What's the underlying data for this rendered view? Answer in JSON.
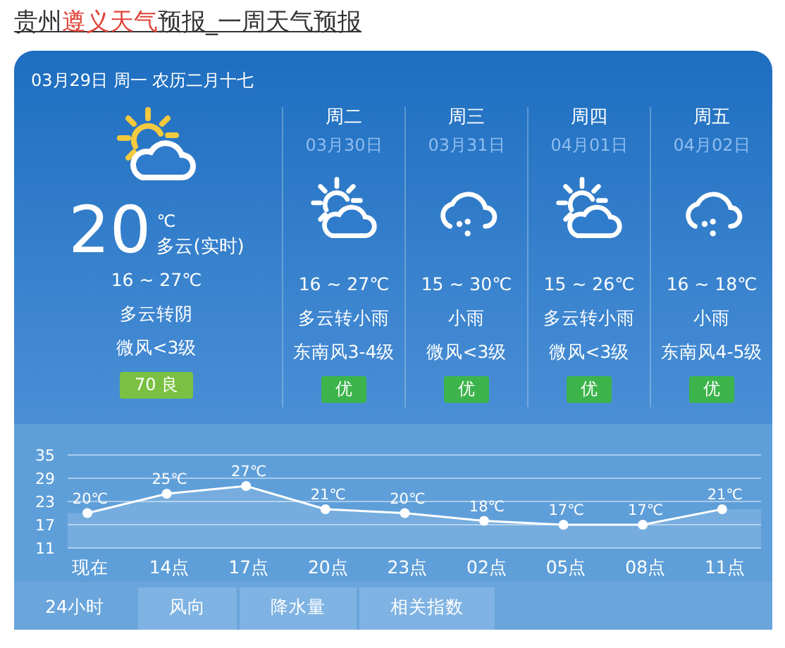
{
  "title": [
    {
      "text": "贵州",
      "highlight": false
    },
    {
      "text": "遵义天气",
      "highlight": true
    },
    {
      "text": "预报_一周天气预报",
      "highlight": false
    }
  ],
  "today": {
    "date": "03月29日 周一 农历二月十七",
    "kind": "partly-cloudy",
    "temp": "20",
    "unit": "℃",
    "now": "多云(实时)",
    "range": "16 ~ 27℃",
    "desc": "多云转阴",
    "wind": "微风<3级",
    "aqi": "70 良",
    "color": "#7ac143"
  },
  "days": [
    {
      "name": "周二",
      "date": "03月30日",
      "kind": "partly-cloudy",
      "range": "16 ~ 27℃",
      "desc": "多云转小雨",
      "wind": "东南风3-4级",
      "aqi": "优",
      "color": "#3cb44b"
    },
    {
      "name": "周三",
      "date": "03月31日",
      "kind": "rain",
      "range": "15 ~ 30℃",
      "desc": "小雨",
      "wind": "微风<3级",
      "aqi": "优",
      "color": "#3cb44b"
    },
    {
      "name": "周四",
      "date": "04月01日",
      "kind": "partly-cloudy",
      "range": "15 ~ 26℃",
      "desc": "多云转小雨",
      "wind": "微风<3级",
      "aqi": "优",
      "color": "#3cb44b"
    },
    {
      "name": "周五",
      "date": "04月02日",
      "kind": "rain",
      "range": "16 ~ 18℃",
      "desc": "小雨",
      "wind": "东南风4-5级",
      "aqi": "优",
      "color": "#3cb44b"
    }
  ],
  "chart_data": {
    "type": "line",
    "categories": [
      "现在",
      "14点",
      "17点",
      "20点",
      "23点",
      "02点",
      "05点",
      "08点",
      "11点"
    ],
    "series": [
      {
        "color": "#ffffff",
        "marker": true,
        "values": [
          20,
          25,
          27,
          21,
          20,
          18,
          17,
          17,
          21
        ]
      }
    ],
    "grid": true,
    "ylim": [
      11,
      35
    ],
    "yticks": [
      11,
      17,
      23,
      29,
      35
    ],
    "value_labels": [
      "20℃",
      "25℃",
      "27℃",
      "21℃",
      "20℃",
      "18℃",
      "17℃",
      "17℃",
      "21℃"
    ]
  },
  "tabs": [
    {
      "label": "24小时",
      "selected": true
    },
    {
      "label": "风向",
      "selected": false
    },
    {
      "label": "降水量",
      "selected": false
    },
    {
      "label": "相关指数",
      "selected": false
    }
  ]
}
